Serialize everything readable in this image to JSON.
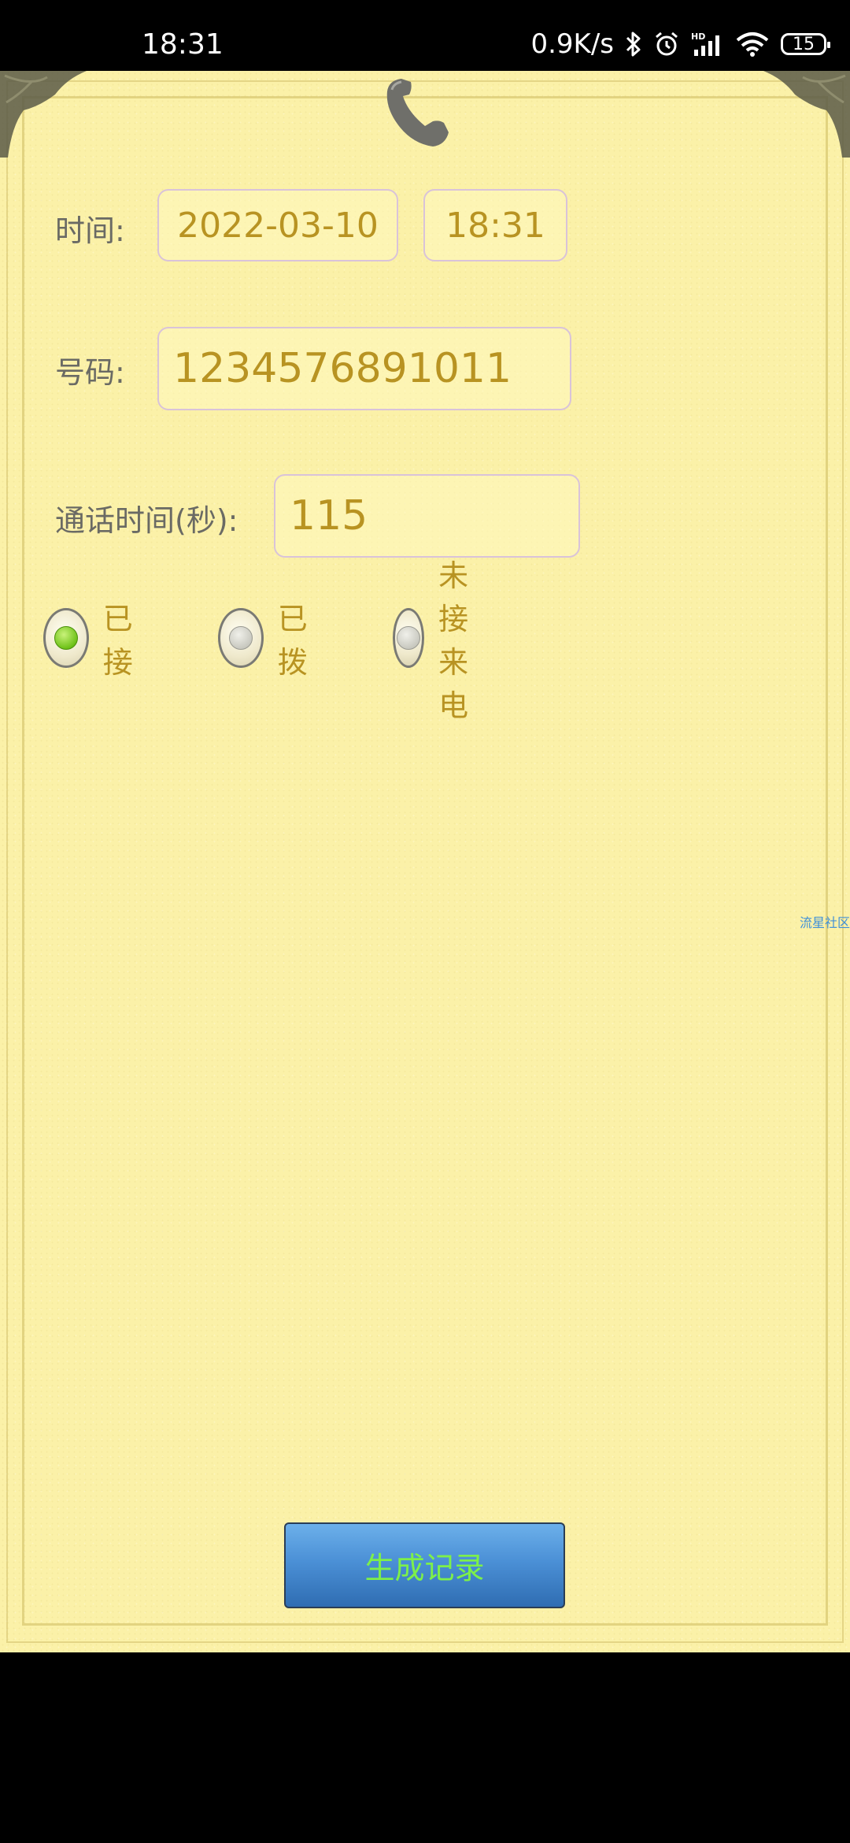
{
  "status_bar": {
    "time": "18:31",
    "network_speed": "0.9K/s",
    "battery_level": "15",
    "icons": [
      "bluetooth-icon",
      "alarm-icon",
      "hd-signal-icon",
      "wifi-icon",
      "battery-icon"
    ]
  },
  "form": {
    "time_label": "时间:",
    "date_value": "2022-03-10",
    "time_value": "18:31",
    "number_label": "号码:",
    "number_value": "1234576891011",
    "duration_label": "通话时间(秒):",
    "duration_value": "115"
  },
  "call_types": {
    "selected_index": 0,
    "options": [
      {
        "label": "已接"
      },
      {
        "label": "已拨"
      },
      {
        "label": "未接来电"
      }
    ]
  },
  "watermark": "流星社区",
  "generate_button": {
    "label": "生成记录"
  },
  "colors": {
    "paper": "#fbf1a8",
    "accent_text": "#b89322",
    "label_text": "#6a6a64",
    "button_blue": "#4b90d6",
    "button_text": "#7df04a",
    "radio_selected": "#6fc219"
  }
}
